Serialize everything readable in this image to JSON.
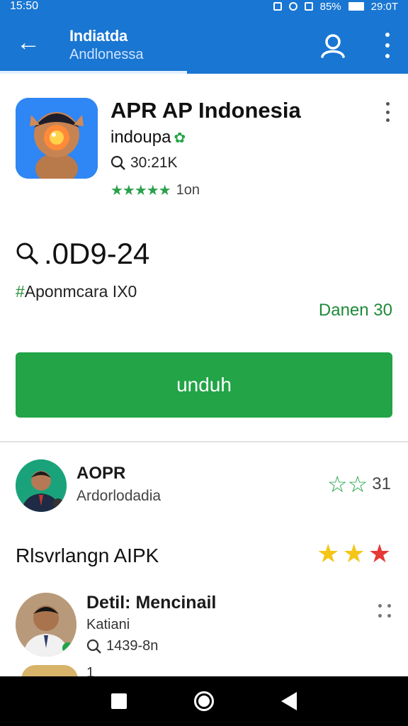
{
  "status_bar": {
    "time": "15:50",
    "battery": "85%",
    "clock": "29:0T"
  },
  "app_bar": {
    "title": "Indiatda",
    "subtitle": "Andlonessa"
  },
  "app": {
    "name": "APR AP Indonesia",
    "developer": "indoupa",
    "downloads": "30:21K",
    "rating_text": "1on",
    "stars": "★★★★★",
    "metric": ".0D9-24",
    "tagline_hash": "#",
    "tagline": "Aponmcara IX0",
    "side_link": "Danen 30",
    "download_label": "unduh"
  },
  "developer_row": {
    "name": "AOPR",
    "subtitle": "Ardorlodadia",
    "stars": "☆☆",
    "count": "31"
  },
  "section": {
    "title": "Rlsvrlangn AIPK",
    "stars_yellow": "★★",
    "stars_red": "★"
  },
  "review": {
    "title": "Detil: Mencinail",
    "subtitle": "Katiani",
    "meta": "1439-8n",
    "peek_meta": "1"
  },
  "colors": {
    "primary": "#1976d2",
    "accent": "#22a447",
    "star_yellow": "#f5c518",
    "star_red": "#e53935"
  }
}
